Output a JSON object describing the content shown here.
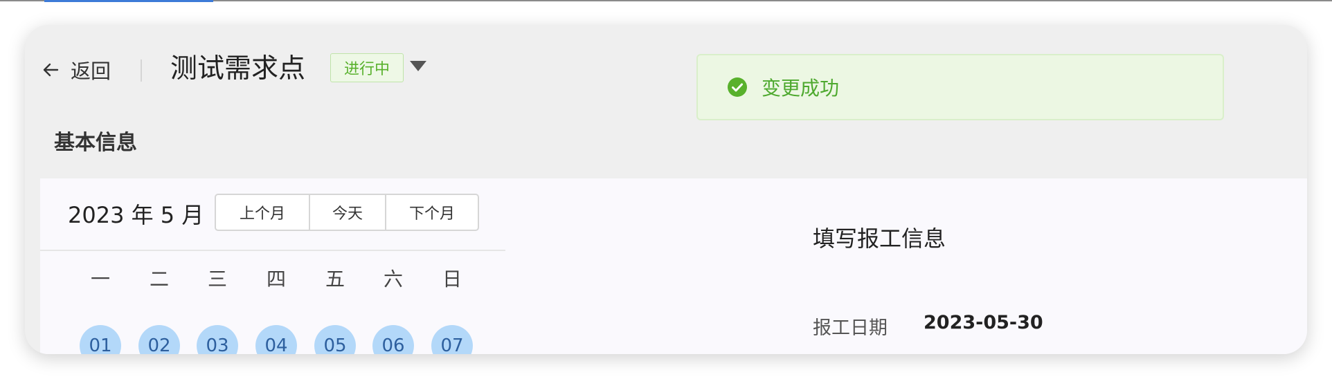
{
  "header": {
    "back_label": "返回",
    "title": "测试需求点",
    "status": "进行中"
  },
  "section": {
    "title": "基本信息"
  },
  "toast": {
    "message": "变更成功"
  },
  "calendar": {
    "month_label": "2023 年 5 月",
    "buttons": {
      "prev": "上个月",
      "today": "今天",
      "next": "下个月"
    },
    "weekdays": [
      "一",
      "二",
      "三",
      "四",
      "五",
      "六",
      "日"
    ],
    "days": [
      "01",
      "02",
      "03",
      "04",
      "05",
      "06",
      "07"
    ]
  },
  "report": {
    "title": "填写报工信息",
    "date_label": "报工日期",
    "date_value": "2023-05-30"
  },
  "colors": {
    "accent": "#3d7bd8",
    "success": "#58b12c",
    "day_highlight": "#b3d8f9"
  }
}
